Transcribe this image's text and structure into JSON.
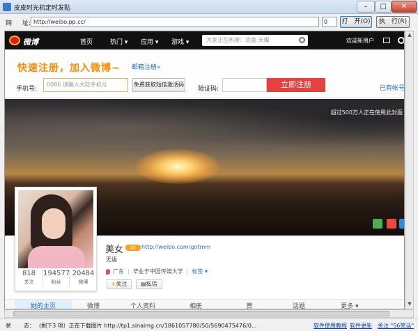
{
  "window": {
    "title": "皮皮时光机定时发贴",
    "min": "–",
    "max": "□",
    "close": "✕"
  },
  "addressbar": {
    "label1": "网",
    "label2": "址:",
    "url": "http://weibo.pp.cc/",
    "count": "0",
    "open_label": "打　开(O)",
    "run_label": "执　行(R)"
  },
  "weibo_nav": {
    "logo": "微博",
    "items": [
      "首页",
      "热门 ▾",
      "应用 ▾",
      "游戏 ▾"
    ],
    "search_placeholder": "大家正在热搜：双曲 天蝎",
    "new_user": "欢迎新用户"
  },
  "register": {
    "slogan": "快速注册，加入微博~",
    "mail_link": "邮箱注册»",
    "phone_label": "手机号:",
    "phone_placeholder": "0086 请输入大陆手机号",
    "sms_button": "免费获取短信激活码",
    "code_label": "验证码:",
    "register_button": "立即注册",
    "have_account": "已有帐号"
  },
  "cover": {
    "users_note": "超过500万人正在使用此封面"
  },
  "profile": {
    "name": "美女",
    "badge": "LV",
    "link": "http://weibo.com/gotmm",
    "bio": "无语",
    "location": "广东",
    "school": "毕业于中国传媒大学",
    "tags": "标签 ▾",
    "follow": "关注",
    "message": "私信",
    "stats": [
      {
        "num": "818",
        "label": "关注"
      },
      {
        "num": "194577",
        "label": "粉丝"
      },
      {
        "num": "20484",
        "label": "微博"
      }
    ]
  },
  "tabs": [
    "她的主页",
    "微博",
    "个人资料",
    "相册",
    "赞",
    "话题",
    "更多 ▾"
  ],
  "statusbar": {
    "label1": "状",
    "label2": "态：",
    "message": "(剩下3 项）正在下载图片 http://tp1.sinaimg.cn/1861057780/50/5690475476/0...",
    "links": [
      "软件使用教程",
      "软件更新",
      "关注 \"56笑话\""
    ]
  }
}
